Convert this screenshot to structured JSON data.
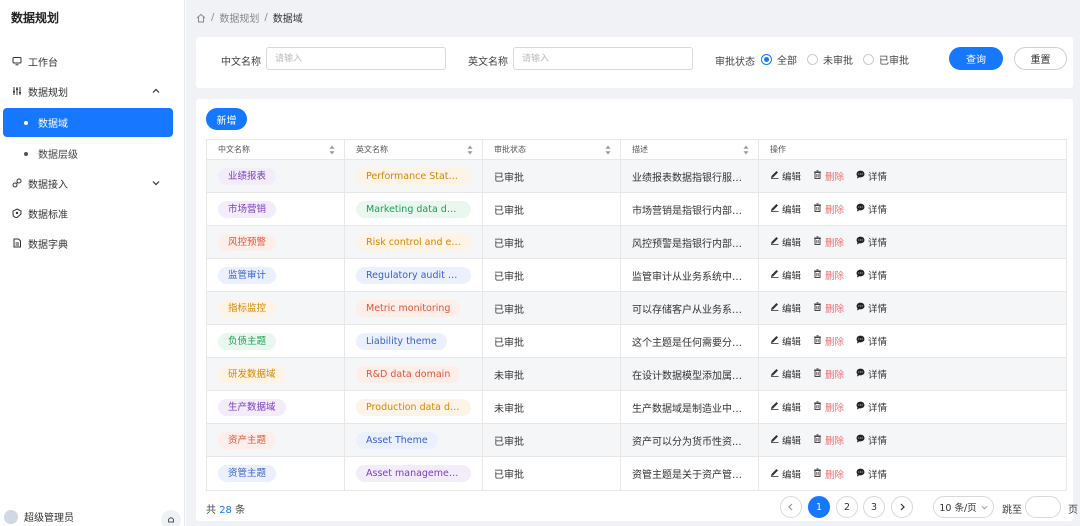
{
  "app": {
    "title": "数据规划"
  },
  "sidebar": {
    "items": [
      {
        "label": "工作台",
        "icon": "monitor-icon"
      },
      {
        "label": "数据规划",
        "icon": "sliders-icon",
        "expanded": true
      },
      {
        "label": "数据接入",
        "icon": "plug-icon"
      },
      {
        "label": "数据标准",
        "icon": "shield-icon"
      },
      {
        "label": "数据字典",
        "icon": "document-icon"
      }
    ],
    "sub_items": [
      {
        "label": "数据域",
        "active": true
      },
      {
        "label": "数据层级",
        "active": false
      }
    ],
    "user": {
      "name": "超级管理员"
    }
  },
  "breadcrumb": {
    "items": [
      "数据规划",
      "数据域"
    ],
    "separator": "/"
  },
  "filter": {
    "cn_label": "中文名称",
    "cn_placeholder": "请输入",
    "en_label": "英文名称",
    "en_placeholder": "请输入",
    "status_label": "审批状态",
    "status_options": [
      "全部",
      "未审批",
      "已审批"
    ],
    "status_selected": "全部",
    "query_label": "查询",
    "reset_label": "重置"
  },
  "toolbar": {
    "add_label": "新增"
  },
  "table": {
    "headers": [
      "中文名称",
      "英文名称",
      "审批状态",
      "描述",
      "操作"
    ],
    "actions": {
      "edit": "编辑",
      "delete": "删除",
      "detail": "详情"
    },
    "rows": [
      {
        "cn": "业绩报表",
        "cn_color": "purple",
        "en": "Performance State...",
        "en_color": "orange",
        "status": "已审批",
        "desc": "业绩报表数据指银行服务..."
      },
      {
        "cn": "市场营销",
        "cn_color": "purple",
        "en": "Marketing data do...",
        "en_color": "green",
        "status": "已审批",
        "desc": "市场营销是指银行内部组..."
      },
      {
        "cn": "风控预警",
        "cn_color": "red",
        "en": "Risk control and ea...",
        "en_color": "orange",
        "status": "已审批",
        "desc": "风控预警是指银行内部组..."
      },
      {
        "cn": "监管审计",
        "cn_color": "blue",
        "en": "Regulatory audit d...",
        "en_color": "blue",
        "status": "已审批",
        "desc": "监管审计从业务系统中可..."
      },
      {
        "cn": "指标监控",
        "cn_color": "orange",
        "en": "Metric monitoring",
        "en_color": "red",
        "status": "已审批",
        "desc": "可以存储客户从业务系统..."
      },
      {
        "cn": "负债主题",
        "cn_color": "green",
        "en": "Liability theme",
        "en_color": "blue",
        "status": "已审批",
        "desc": "这个主题是任何需要分析..."
      },
      {
        "cn": "研发数据域",
        "cn_color": "orange",
        "en": "R&D data domain",
        "en_color": "red",
        "status": "未审批",
        "desc": "在设计数据模型添加属性..."
      },
      {
        "cn": "生产数据域",
        "cn_color": "purple",
        "en": "Production data do...",
        "en_color": "orange",
        "status": "未审批",
        "desc": "生产数据域是制造业中最..."
      },
      {
        "cn": "资产主题",
        "cn_color": "red",
        "en": "Asset Theme",
        "en_color": "blue",
        "status": "已审批",
        "desc": "资产可以分为货币性资..."
      },
      {
        "cn": "资管主题",
        "cn_color": "blue",
        "en": "Asset management...",
        "en_color": "purple",
        "status": "已审批",
        "desc": "资管主题是关于资产管理..."
      }
    ]
  },
  "pagination": {
    "total_prefix": "共",
    "total": "28",
    "total_suffix": "条",
    "pages": [
      "1",
      "2",
      "3"
    ],
    "current": "1",
    "page_size": "10 条/页",
    "jump_label": "跳至",
    "jump_suffix": "页"
  },
  "colors": {
    "accent": "#1677ff",
    "delete": "#f56c6c",
    "tag_purple": [
      "#f3ecfb",
      "#7a3fc0"
    ],
    "tag_orange": [
      "#fdf3e6",
      "#d48806"
    ],
    "tag_red": [
      "#fdeeea",
      "#e2553a"
    ],
    "tag_blue": [
      "#eaf0fd",
      "#3a5fd0"
    ],
    "tag_green": [
      "#e9f7ef",
      "#1f9d55"
    ]
  }
}
